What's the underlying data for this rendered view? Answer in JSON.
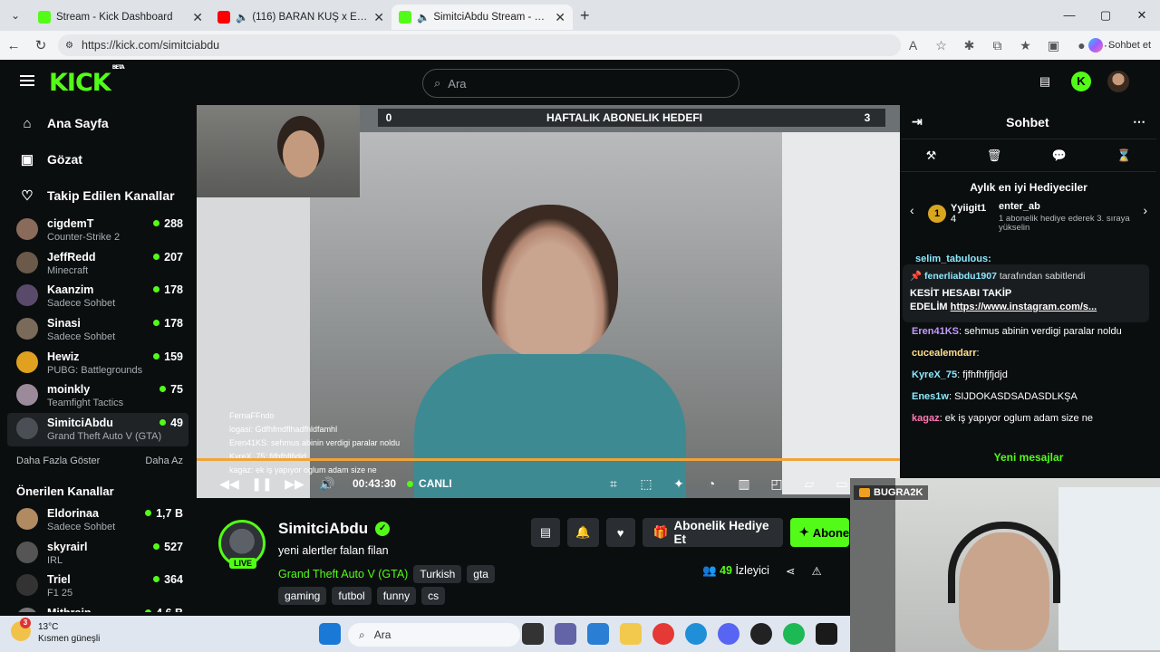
{
  "browser": {
    "tabs": [
      {
        "title": "Stream - Kick Dashboard",
        "active": false
      },
      {
        "title": "(116) BARAN KUŞ x ERAY CAN",
        "active": false
      },
      {
        "title": "SimitciAbdu Stream - Watch L",
        "active": true
      }
    ],
    "new_tab": "+",
    "url": "https://kick.com/simitciabdu",
    "copilot_label": "Sohbet et"
  },
  "header": {
    "logo": "KICK",
    "logo_beta": "BETA",
    "search_placeholder": "Ara"
  },
  "sidebar": {
    "nav": [
      {
        "label": "Ana Sayfa",
        "icon": "home-icon"
      },
      {
        "label": "Gözat",
        "icon": "browse-icon"
      },
      {
        "label": "Takip Edilen Kanallar",
        "icon": "heart-icon"
      }
    ],
    "followed": [
      {
        "name": "cigdemT",
        "game": "Counter-Strike 2",
        "viewers": "288",
        "color": "#8a6a5a"
      },
      {
        "name": "JeffRedd",
        "game": "Minecraft",
        "viewers": "207",
        "color": "#6b5a4a"
      },
      {
        "name": "Kaanzim",
        "game": "Sadece Sohbet",
        "viewers": "178",
        "color": "#5a4a6a"
      },
      {
        "name": "Sinasi",
        "game": "Sadece Sohbet",
        "viewers": "178",
        "color": "#7a6a5a"
      },
      {
        "name": "Hewiz",
        "game": "PUBG: Battlegrounds",
        "viewers": "159",
        "color": "#e0a020"
      },
      {
        "name": "moinkly",
        "game": "Teamfight Tactics",
        "viewers": "75",
        "color": "#9a8a9a"
      },
      {
        "name": "SimitciAbdu",
        "game": "Grand Theft Auto V (GTA)",
        "viewers": "49",
        "color": "#4a4f55",
        "selected": true
      }
    ],
    "show_more": "Daha Fazla Göster",
    "show_less": "Daha Az",
    "recommended_title": "Önerilen Kanallar",
    "recommended": [
      {
        "name": "Eldorinaa",
        "game": "Sadece Sohbet",
        "viewers": "1,7 B",
        "color": "#b08a60"
      },
      {
        "name": "skyrairl",
        "game": "IRL",
        "viewers": "527",
        "color": "#555"
      },
      {
        "name": "Triel",
        "game": "F1 25",
        "viewers": "364",
        "color": "#333"
      },
      {
        "name": "Mithrain",
        "game": "",
        "viewers": "4,6 B",
        "color": "#777"
      }
    ]
  },
  "video": {
    "goal_left": "0",
    "goal_title": "HAFTALIK ABONELIK HEDEFI",
    "goal_right": "3",
    "overlay_chat": [
      "FernaFFndo",
      "logasi: Gdfhfmdflhadfhldfamhl",
      "Eren41KS: sehmus abinin verdigi paralar noldu",
      "KyreX_75: fjfhfhfjfjdjd",
      "kagaz: ek iş yapıyor oglum adam size ne"
    ],
    "time": "00:43:30",
    "live_label": "CANLI"
  },
  "stream": {
    "name": "SimitciAbdu",
    "title": "yeni alertler falan filan",
    "live_badge": "LIVE",
    "category": "Grand Theft Auto V (GTA)",
    "tags": [
      "Turkish",
      "gta"
    ],
    "tags2": [
      "gaming",
      "futbol",
      "funny",
      "cs"
    ],
    "gift_label": "Abonelik Hediye Et",
    "subscribe_label": "Abone",
    "viewers": "49",
    "viewers_label": "İzleyici"
  },
  "chat": {
    "title": "Sohbet",
    "gifters_title": "Aylık en iyi Hediyeciler",
    "gifter1": {
      "rank": "1",
      "name": "Yyiigit1",
      "count": "4"
    },
    "gifter2": {
      "name": "enter_ab",
      "count": "1",
      "note": "1 abonelik hediye ederek 3. sıraya yükselin"
    },
    "partial_user": "selim_tabulous:",
    "pinned": {
      "by": "fenerliabdu1907",
      "by_suffix": "tarafından sabitlendi",
      "line1": "KESİT HESABI TAKİP",
      "line2": "EDELİM ",
      "link": "https://www.instagram.com/s..."
    },
    "messages": [
      {
        "user": "Eren41KS",
        "text": "sehmus abinin verdigi paralar noldu",
        "color": "#c39bff"
      },
      {
        "user": "cucealemdarr",
        "text": "",
        "color": "#ffe08a"
      },
      {
        "user": "KyreX_75",
        "text": "fjfhfhfjfjdjd",
        "color": "#8be9ff"
      },
      {
        "user": "Enes1w",
        "text": "SIJDOKASDSADASDLKŞA",
        "color": "#8be9ff"
      },
      {
        "user": "kagaz",
        "text": "ek iş yapıyor oglum adam size ne",
        "color": "#ff7ab6"
      }
    ],
    "new_messages": "Yeni mesajlar"
  },
  "webcam": {
    "label": "BUGRA2K"
  },
  "taskbar": {
    "temp": "13°C",
    "weather": "Kısmen güneşli",
    "badge": "3",
    "search_placeholder": "Ara"
  }
}
